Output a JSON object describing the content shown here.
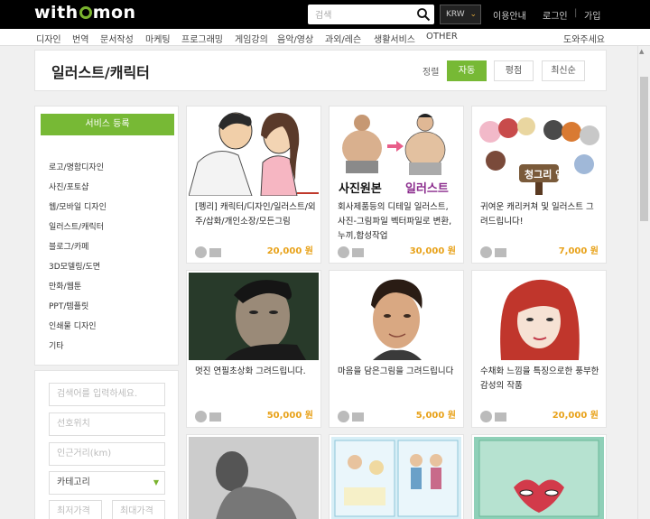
{
  "header": {
    "logo": "withmon",
    "search_placeholder": "검색",
    "currency": "KRW",
    "links": [
      "이용안내",
      "로그인",
      "가입"
    ]
  },
  "nav": {
    "categories": [
      "디자인",
      "번역",
      "문서작성",
      "마케팅",
      "프로그래밍",
      "게임강의",
      "음악/영상",
      "과외/레슨",
      "생활서비스",
      "OTHER"
    ],
    "help": "도와주세요"
  },
  "page": {
    "title": "일러스트/캐릭터",
    "sort_label": "정렬",
    "sort_options": [
      "자동",
      "평점",
      "최신순"
    ],
    "active_sort": "자동"
  },
  "sidebar": {
    "register_button": "서비스 등록",
    "menu": [
      "로고/명함디자인",
      "사진/포토샵",
      "웹/모바일 디자인",
      "일러스트/캐릭터",
      "블로그/카페",
      "3D모델링/도면",
      "만화/웹툰",
      "PPT/템플릿",
      "인쇄물 디자인",
      "기타"
    ],
    "filters": {
      "search_placeholder": "검색어를 입력하세요.",
      "location_placeholder": "선호위치",
      "distance_placeholder": "인근거리(km)",
      "category": "카테고리",
      "min_price": "최저가격",
      "max_price": "최대가격"
    }
  },
  "listings": [
    {
      "title": "[펭리] 캐릭터/디자인/일러스트/외주/삽화/개인소장/모든그림",
      "price": "20,000 원"
    },
    {
      "title": "회사제품등의 디테일 일러스트, 사진-그림파일 벡터파일로 변환,누끼,합성작업",
      "price": "30,000 원"
    },
    {
      "title": "귀여운 캐리커쳐 및 일러스트 그려드립니다!",
      "price": "7,000 원"
    },
    {
      "title": "멋진 연필초상화 그려드립니다.",
      "price": "50,000 원"
    },
    {
      "title": "마음을 담은그림을 그려드립니다",
      "price": "5,000 원"
    },
    {
      "title": "수채화 느낌을 특징으로한 풍부한 감성의 작품",
      "price": "20,000 원"
    }
  ],
  "image_texts": {
    "card2_before": "사진원본",
    "card2_after": "일러스트",
    "card3_banner": "청그리 앱"
  },
  "colors": {
    "accent_green": "#77b935",
    "price_orange": "#e8a21a",
    "topbar": "#000000"
  }
}
